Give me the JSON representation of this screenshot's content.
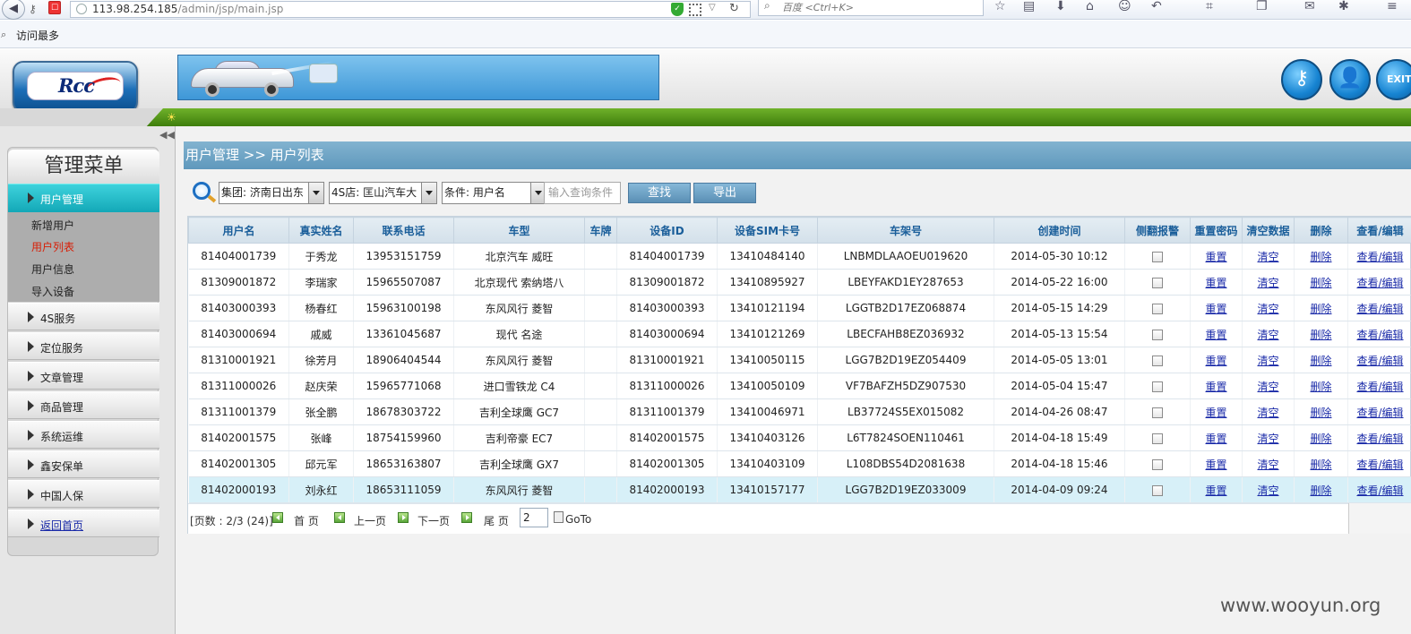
{
  "browser": {
    "url_host": "113.98.254.185",
    "url_path": "/admin/jsp/main.jsp",
    "search_placeholder": "百度 <Ctrl+K>",
    "bookmark": "访问最多"
  },
  "header": {
    "logo_text": "Rcc",
    "exit_label": "EXIT"
  },
  "sidebar": {
    "title": "管理菜单",
    "active_menu": "用户管理",
    "sub_items": [
      "新增用户",
      "用户列表",
      "用户信息",
      "导入设备"
    ],
    "current_sub": "用户列表",
    "items": [
      "4S服务",
      "定位服务",
      "文章管理",
      "商品管理",
      "系统运维",
      "鑫安保单",
      "中国人保",
      "返回首页"
    ]
  },
  "breadcrumb": "用户管理 >> 用户列表",
  "filters": {
    "group": "集团: 济南日出东",
    "shop": "4S店: 匡山汽车大",
    "condition": "条件: 用户名",
    "query_placeholder": "输入查询条件",
    "search_btn": "查找",
    "export_btn": "导出"
  },
  "table": {
    "columns": [
      "用户名",
      "真实姓名",
      "联系电话",
      "车型",
      "车牌",
      "设备ID",
      "设备SIM卡号",
      "车架号",
      "创建时间",
      "侧翻报警",
      "重置密码",
      "清空数据",
      "删除",
      "查看/编辑"
    ],
    "actions": {
      "reset": "重置",
      "clear": "清空",
      "delete": "删除",
      "view": "查看/编辑"
    },
    "rows": [
      {
        "user": "81404001739",
        "name": "于秀龙",
        "phone": "13953151759",
        "model": "北京汽车 威旺",
        "plate": "",
        "device": "81404001739",
        "sim": "13410484140",
        "vin": "LNBMDLAAOEU019620",
        "time": "2014-05-30 10:12"
      },
      {
        "user": "81309001872",
        "name": "李瑞家",
        "phone": "15965507087",
        "model": "北京现代 索纳塔八",
        "plate": "",
        "device": "81309001872",
        "sim": "13410895927",
        "vin": "LBEYFAKD1EY287653",
        "time": "2014-05-22 16:00"
      },
      {
        "user": "81403000393",
        "name": "杨春红",
        "phone": "15963100198",
        "model": "东风风行 菱智",
        "plate": "",
        "device": "81403000393",
        "sim": "13410121194",
        "vin": "LGGTB2D17EZ068874",
        "time": "2014-05-15 14:29"
      },
      {
        "user": "81403000694",
        "name": "戚威",
        "phone": "13361045687",
        "model": "现代 名途",
        "plate": "",
        "device": "81403000694",
        "sim": "13410121269",
        "vin": "LBECFAHB8EZ036932",
        "time": "2014-05-13 15:54"
      },
      {
        "user": "81310001921",
        "name": "徐芳月",
        "phone": "18906404544",
        "model": "东风风行 菱智",
        "plate": "",
        "device": "81310001921",
        "sim": "13410050115",
        "vin": "LGG7B2D19EZ054409",
        "time": "2014-05-05 13:01"
      },
      {
        "user": "81311000026",
        "name": "赵庆荣",
        "phone": "15965771068",
        "model": "进口雪铁龙 C4",
        "plate": "",
        "device": "81311000026",
        "sim": "13410050109",
        "vin": "VF7BAFZH5DZ907530",
        "time": "2014-05-04 15:47"
      },
      {
        "user": "81311001379",
        "name": "张全鹏",
        "phone": "18678303722",
        "model": "吉利全球鹰 GC7",
        "plate": "",
        "device": "81311001379",
        "sim": "13410046971",
        "vin": "LB37724S5EX015082",
        "time": "2014-04-26 08:47"
      },
      {
        "user": "81402001575",
        "name": "张峰",
        "phone": "18754159960",
        "model": "吉利帝豪 EC7",
        "plate": "",
        "device": "81402001575",
        "sim": "13410403126",
        "vin": "L6T7824SOEN110461",
        "time": "2014-04-18 15:49"
      },
      {
        "user": "81402001305",
        "name": "邱元军",
        "phone": "18653163807",
        "model": "吉利全球鹰 GX7",
        "plate": "",
        "device": "81402001305",
        "sim": "13410403109",
        "vin": "L108DBS54D2081638",
        "time": "2014-04-18 15:46"
      },
      {
        "user": "81402000193",
        "name": "刘永红",
        "phone": "18653111059",
        "model": "东风风行 菱智",
        "plate": "",
        "device": "81402000193",
        "sim": "13410157177",
        "vin": "LGG7B2D19EZ033009",
        "time": "2014-04-09 09:24"
      }
    ]
  },
  "pager": {
    "info": "[页数 : 2/3 (24)]",
    "first": "首 页",
    "prev": "上一页",
    "next": "下一页",
    "last": "尾 页",
    "page_value": "2",
    "goto": "GoTo"
  },
  "watermark": "www.wooyun.org"
}
